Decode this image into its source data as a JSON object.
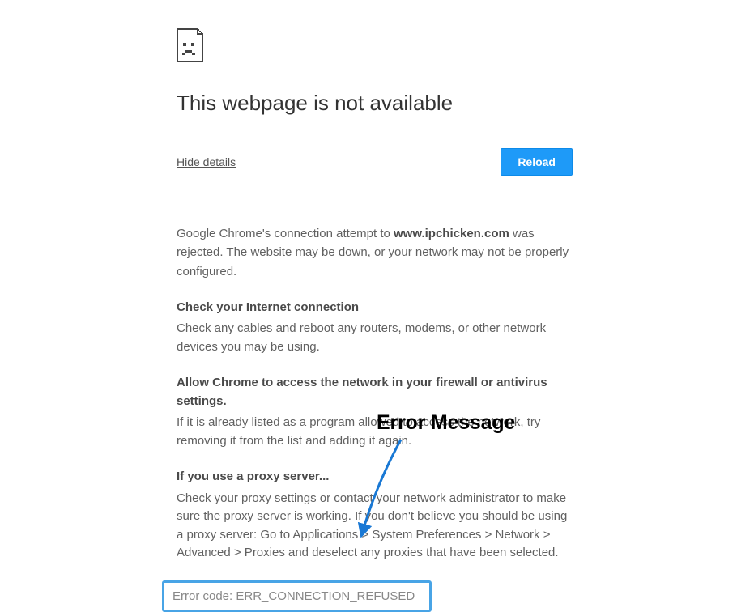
{
  "title": "This webpage is not available",
  "hideDetails": "Hide details",
  "reload": "Reload",
  "intro_prefix": "Google Chrome's connection attempt to ",
  "intro_domain": "www.ipchicken.com",
  "intro_suffix": " was rejected. The website may be down, or your network may not be properly configured.",
  "sections": [
    {
      "heading": "Check your Internet connection",
      "body": "Check any cables and reboot any routers, modems, or other network devices you may be using."
    },
    {
      "heading": "Allow Chrome to access the network in your firewall or antivirus settings.",
      "body": "If it is already listed as a program allowed to access the network, try removing it from the list and adding it again."
    },
    {
      "heading": "If you use a proxy server...",
      "body": "Check your proxy settings or contact your network administrator to make sure the proxy server is working. If you don't believe you should be using a proxy server: Go to Applications > System Preferences > Network > Advanced > Proxies and deselect any proxies that have been selected."
    }
  ],
  "errorCode": "Error code: ERR_CONNECTION_REFUSED",
  "annotation": "Error Message"
}
